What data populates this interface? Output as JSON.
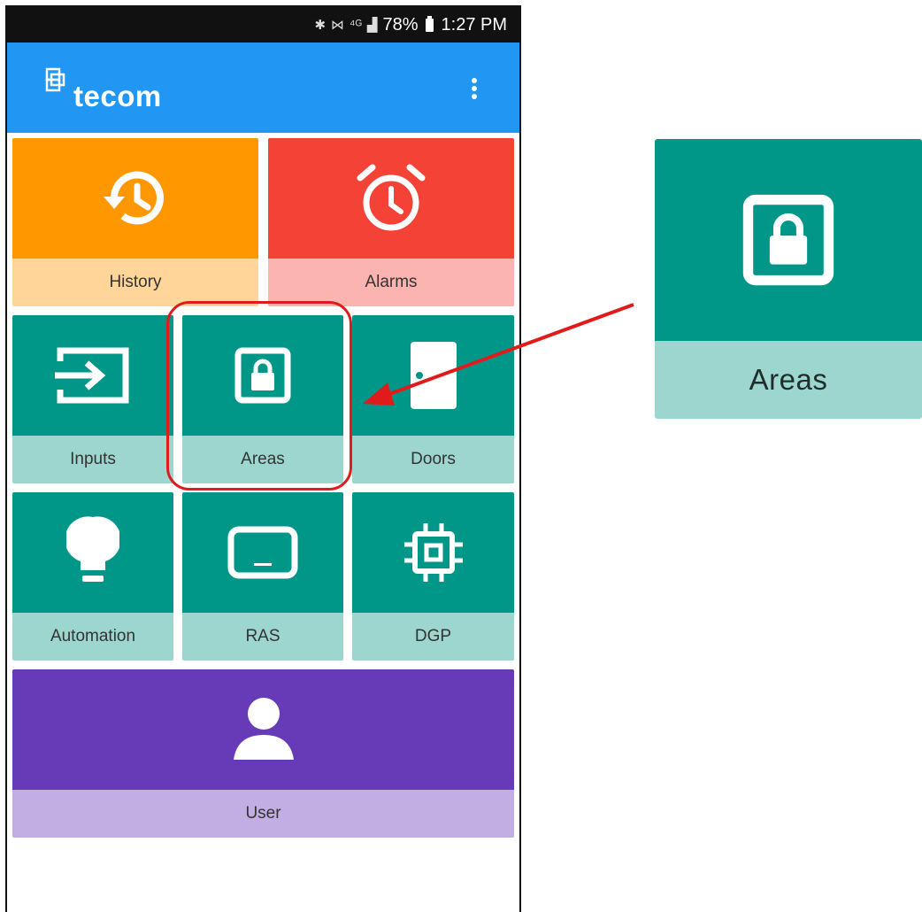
{
  "status_bar": {
    "icons": [
      "bluetooth-icon",
      "mute-icon",
      "lte-icon",
      "signal-icon"
    ],
    "battery": "78%",
    "time": "1:27 PM"
  },
  "app_bar": {
    "logo_text": "tecom",
    "menu_icon": "more-vert-icon"
  },
  "tiles": {
    "history": {
      "label": "History",
      "icon": "history-icon"
    },
    "alarms": {
      "label": "Alarms",
      "icon": "alarm-clock-icon"
    },
    "inputs": {
      "label": "Inputs",
      "icon": "input-icon"
    },
    "areas": {
      "label": "Areas",
      "icon": "lock-icon"
    },
    "doors": {
      "label": "Doors",
      "icon": "door-icon"
    },
    "automation": {
      "label": "Automation",
      "icon": "lightbulb-icon"
    },
    "ras": {
      "label": "RAS",
      "icon": "keypad-icon"
    },
    "dgp": {
      "label": "DGP",
      "icon": "chip-icon"
    },
    "user": {
      "label": "User",
      "icon": "person-icon"
    }
  },
  "zoom_callout": {
    "label": "Areas",
    "icon": "lock-icon"
  },
  "colors": {
    "app_bar": "#2196f3",
    "history": "#ff9800",
    "alarms": "#f44336",
    "teal": "#009688",
    "user": "#673ab7",
    "highlight": "#e01b1b"
  }
}
